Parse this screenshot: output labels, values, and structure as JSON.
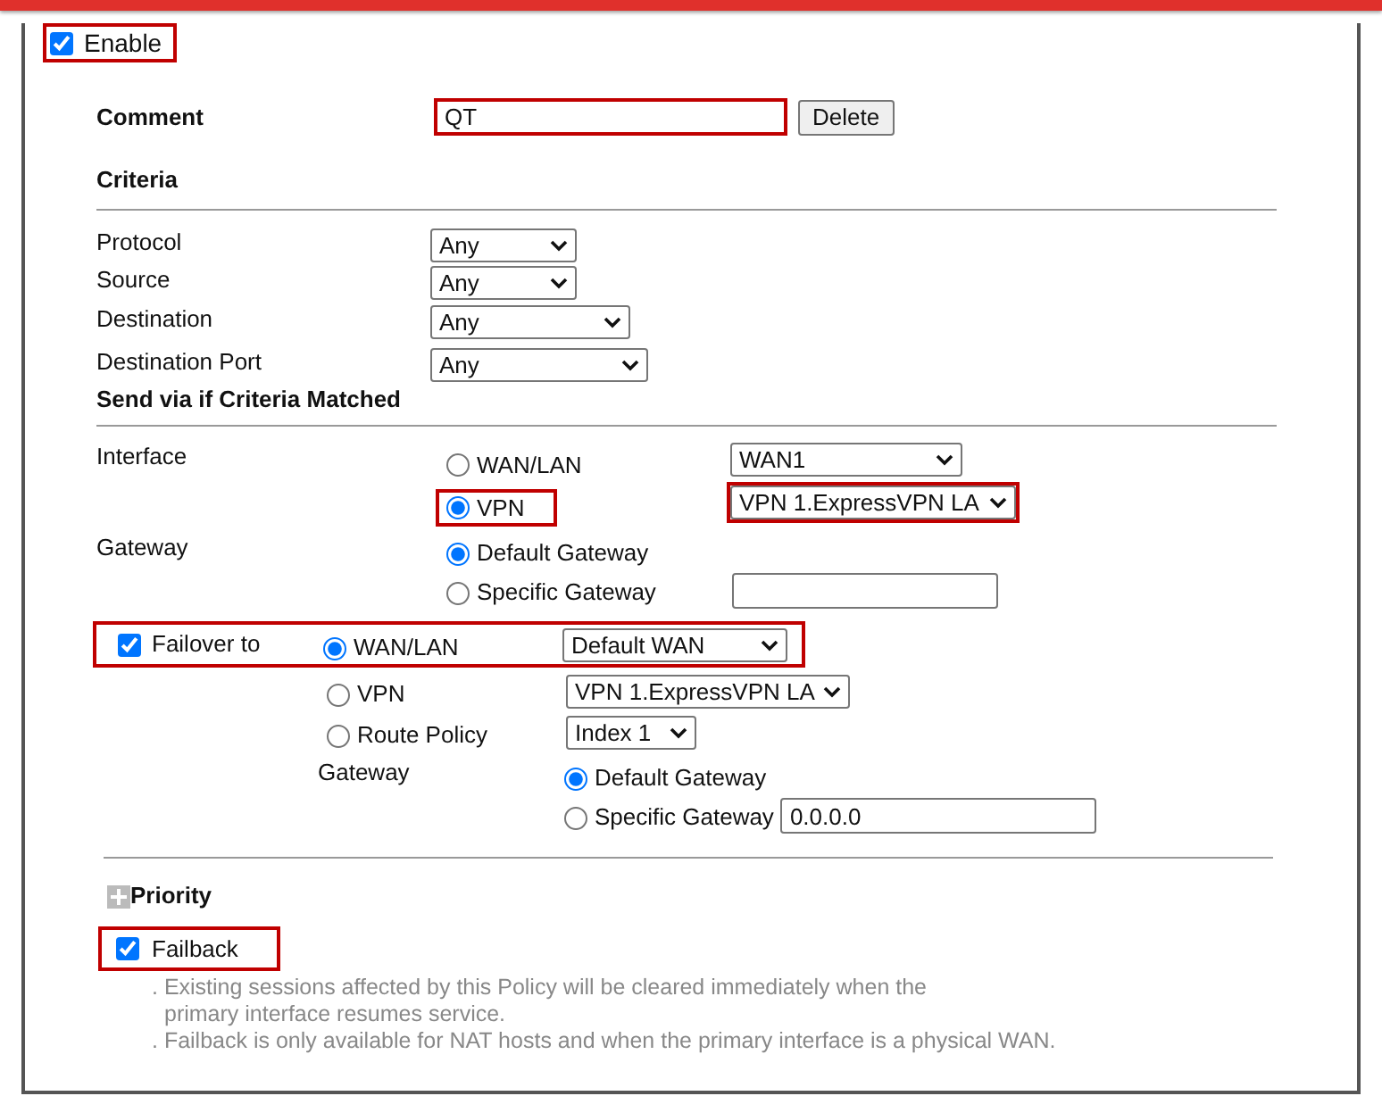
{
  "enable": {
    "label": "Enable",
    "checked": true,
    "highlighted": true
  },
  "comment": {
    "label": "Comment",
    "value": "QT",
    "highlighted": true,
    "button": "Delete"
  },
  "criteria": {
    "title": "Criteria",
    "fields": [
      {
        "label": "Protocol",
        "value": "Any"
      },
      {
        "label": "Source",
        "value": "Any"
      },
      {
        "label": "Destination",
        "value": "Any"
      },
      {
        "label": "Destination Port",
        "value": "Any"
      }
    ]
  },
  "send_via": {
    "title": "Send via if Criteria Matched",
    "interface": {
      "label": "Interface",
      "options": [
        {
          "label": "WAN/LAN",
          "selected": false,
          "highlighted": false,
          "select": "WAN1",
          "select_highlighted": false
        },
        {
          "label": "VPN",
          "selected": true,
          "highlighted": true,
          "select": "VPN 1.ExpressVPN LA",
          "select_highlighted": true
        }
      ]
    },
    "gateway": {
      "label": "Gateway",
      "options": [
        {
          "label": "Default Gateway",
          "selected": true
        },
        {
          "label": "Specific Gateway",
          "selected": false,
          "kind": "field"
        }
      ]
    }
  },
  "failover": {
    "label": "Failover to",
    "checked": true,
    "highlighted": true,
    "options": [
      {
        "label": "WAN/LAN",
        "selected": true,
        "select": "Default WAN"
      },
      {
        "label": "VPN",
        "selected": false,
        "select": "VPN 1.ExpressVPN LA"
      },
      {
        "label": "Route Policy",
        "selected": false,
        "select": "Index 1"
      }
    ],
    "gateway": {
      "label": "Gateway",
      "options": [
        {
          "label": "Default Gateway",
          "selected": true
        },
        {
          "label": "Specific Gateway",
          "selected": false,
          "kind": "field",
          "value": "0.0.0.0"
        }
      ]
    }
  },
  "priority": {
    "label": "Priority",
    "expanded": false
  },
  "failback": {
    "label": "Failback",
    "checked": true,
    "highlighted": true,
    "notes": [
      ". Existing sessions affected by this Policy will be cleared immediately when the primary interface resumes service.",
      ". Failback is only available for NAT hosts and when the primary interface is a physical WAN."
    ]
  }
}
